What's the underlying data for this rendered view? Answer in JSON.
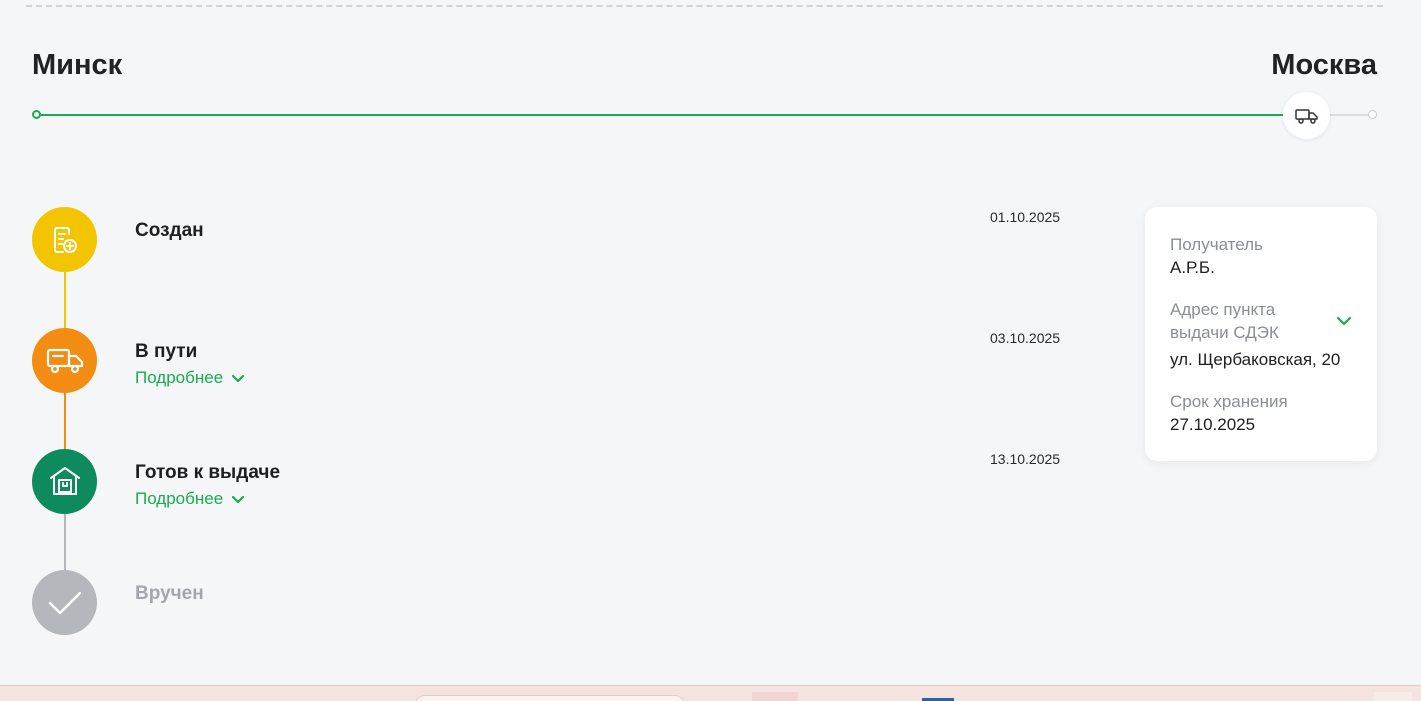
{
  "route": {
    "from_city": "Минск",
    "to_city": "Москва",
    "progress_fraction": 0.93
  },
  "steps": [
    {
      "title": "Создан",
      "date": "01.10.2025",
      "more": "",
      "icon": "document-plus-icon",
      "color": "#f2c500",
      "state": "done"
    },
    {
      "title": "В пути",
      "date": "03.10.2025",
      "more": "Подробнее",
      "icon": "truck-icon",
      "color": "#f28c13",
      "state": "done"
    },
    {
      "title": "Готов к выдаче",
      "date": "13.10.2025",
      "more": "Подробнее",
      "icon": "warehouse-icon",
      "color": "#0e8a5f",
      "state": "current"
    },
    {
      "title": "Вручен",
      "date": "",
      "more": "",
      "icon": "checkmark-icon",
      "color": "#b4b7bc",
      "state": "pending"
    }
  ],
  "info": {
    "recipient_label": "Получатель",
    "recipient_value": "А.Р.Б.",
    "address_label": "Адрес пункта выдачи СДЭК",
    "address_value": "ул. Щербаковская, 20",
    "storage_label": "Срок хранения",
    "storage_value": "27.10.2025"
  },
  "colors": {
    "accent_green": "#1aab52",
    "step_created": "#f2c500",
    "step_transit": "#f28c13",
    "step_ready": "#0e8a5f",
    "step_pending": "#b4b7bc"
  }
}
